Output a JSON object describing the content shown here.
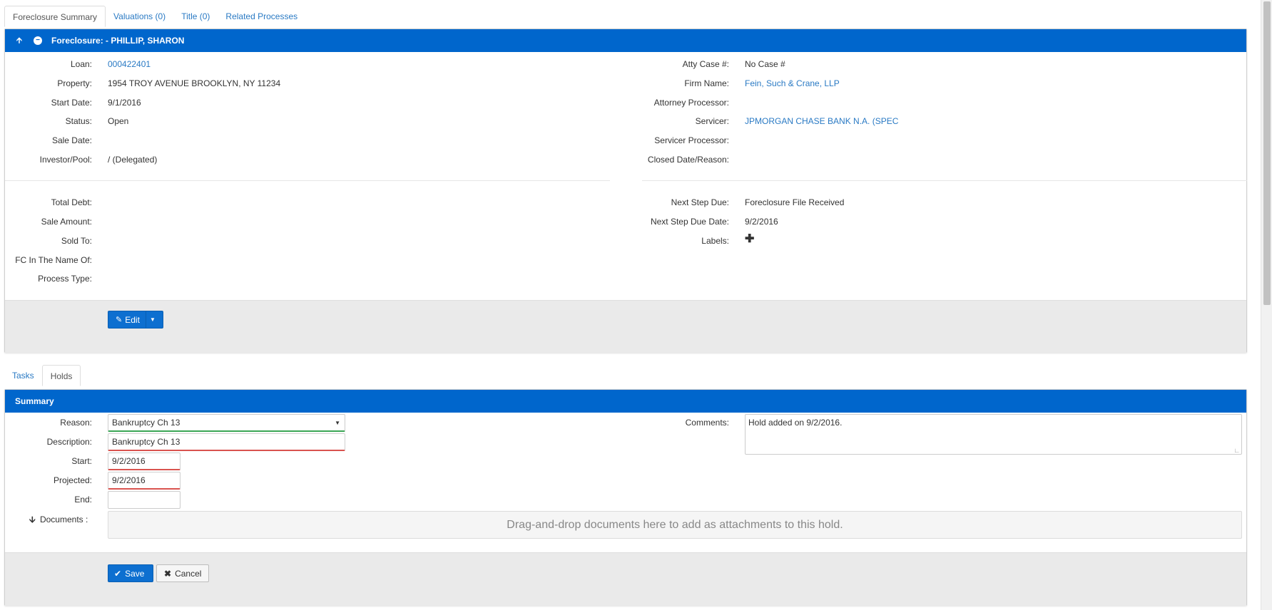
{
  "top_tabs": [
    {
      "label": "Foreclosure Summary",
      "active": true
    },
    {
      "label": "Valuations (0)",
      "active": false
    },
    {
      "label": "Title (0)",
      "active": false
    },
    {
      "label": "Related Processes",
      "active": false
    }
  ],
  "foreclosure_panel": {
    "title": "Foreclosure: - PHILLIP, SHARON",
    "left_fields": [
      {
        "label": "Loan:",
        "value": "000422401",
        "link": true
      },
      {
        "label": "Property:",
        "value": "1954 TROY AVENUE BROOKLYN, NY 11234"
      },
      {
        "label": "Start Date:",
        "value": "9/1/2016"
      },
      {
        "label": "Status:",
        "value": "Open"
      },
      {
        "label": "Sale Date:",
        "value": ""
      },
      {
        "label": "Investor/Pool:",
        "value": "/ (Delegated)"
      }
    ],
    "right_fields": [
      {
        "label": "Atty Case #:",
        "value": "No Case #"
      },
      {
        "label": "Firm Name:",
        "value": "Fein, Such & Crane, LLP",
        "link": true
      },
      {
        "label": "Attorney Processor:",
        "value": ""
      },
      {
        "label": "Servicer:",
        "value": "JPMORGAN CHASE BANK N.A. (SPEC",
        "link": true
      },
      {
        "label": "Servicer Processor:",
        "value": ""
      },
      {
        "label": "Closed Date/Reason:",
        "value": ""
      }
    ],
    "left_fields_2": [
      {
        "label": "Total Debt:",
        "value": ""
      },
      {
        "label": "Sale Amount:",
        "value": ""
      },
      {
        "label": "Sold To:",
        "value": ""
      },
      {
        "label": "FC In The Name Of:",
        "value": ""
      },
      {
        "label": "Process Type:",
        "value": ""
      }
    ],
    "right_fields_2": [
      {
        "label": "Next Step Due:",
        "value": "Foreclosure File Received"
      },
      {
        "label": "Next Step Due Date:",
        "value": "9/2/2016"
      },
      {
        "label": "Labels:",
        "value": ""
      }
    ],
    "edit_label": "Edit"
  },
  "sub_tabs": [
    {
      "label": "Tasks",
      "active": false
    },
    {
      "label": "Holds",
      "active": true
    }
  ],
  "summary_panel": {
    "title": "Summary",
    "reason_label": "Reason:",
    "reason_value": "Bankruptcy Ch 13",
    "description_label": "Description:",
    "description_value": "Bankruptcy Ch 13",
    "start_label": "Start:",
    "start_value": "9/2/2016",
    "projected_label": "Projected:",
    "projected_value": "9/2/2016",
    "end_label": "End:",
    "end_value": "",
    "documents_label": "Documents :",
    "dropzone_text": "Drag-and-drop documents here to add as attachments to this hold.",
    "comments_label": "Comments:",
    "comments_value": "Hold added on 9/2/2016.",
    "save_label": "Save",
    "cancel_label": "Cancel"
  },
  "colors": {
    "header_blue": "#0066cc",
    "link_blue": "#2a7ac4",
    "error_red": "#d9534f",
    "valid_green": "#3aa655",
    "footer_gray": "#eaeaea"
  }
}
